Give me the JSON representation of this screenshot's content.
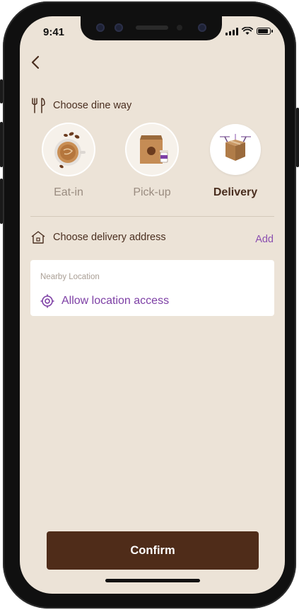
{
  "status_bar": {
    "time": "9:41"
  },
  "dine_way": {
    "title": "Choose dine way",
    "options": [
      {
        "label": "Eat-in",
        "selected": false
      },
      {
        "label": "Pick-up",
        "selected": false
      },
      {
        "label": "Delivery",
        "selected": true
      }
    ]
  },
  "delivery_address": {
    "title": "Choose delivery address",
    "add_label": "Add",
    "nearby_label": "Nearby Location",
    "allow_location_label": "Allow location access"
  },
  "footer": {
    "confirm_label": "Confirm"
  },
  "colors": {
    "background": "#ece3d7",
    "primary_brown": "#4f2c19",
    "accent_purple": "#8b4fb0",
    "card": "#ffffff"
  },
  "icons": [
    "back-chevron-icon",
    "fork-spoon-icon",
    "home-icon",
    "location-target-icon",
    "signal-icon",
    "wifi-icon",
    "battery-icon"
  ]
}
